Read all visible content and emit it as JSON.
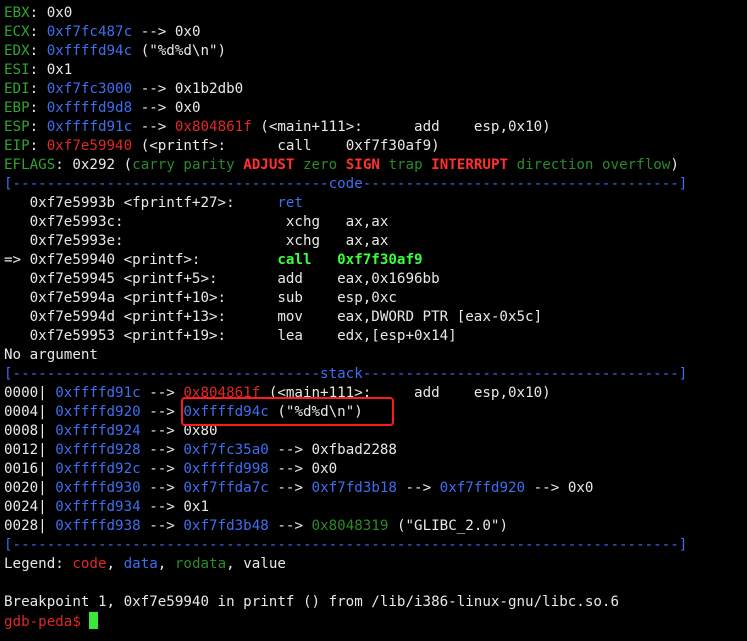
{
  "registers": {
    "ebx": {
      "name": "EBX",
      "value": "0x0"
    },
    "ecx": {
      "name": "ECX",
      "addr": "0xf7fc487c",
      "arrow": "-->",
      "deref": "0x0"
    },
    "edx": {
      "name": "EDX",
      "addr": "0xffffd94c",
      "str": "(\"%d%d\\n\")"
    },
    "esi": {
      "name": "ESI",
      "value": "0x1"
    },
    "edi": {
      "name": "EDI",
      "addr": "0xf7fc3000",
      "arrow": "-->",
      "deref": "0x1b2db0"
    },
    "ebp": {
      "name": "EBP",
      "addr": "0xffffd9d8",
      "arrow": "-->",
      "deref": "0x0"
    },
    "esp": {
      "name": "ESP",
      "addr": "0xffffd91c",
      "arrow": "-->",
      "code": "0x804861f",
      "sym": "(<main+111>:",
      "op": "add",
      "args": "esp,0x10)"
    },
    "eip": {
      "name": "EIP",
      "code": "0xf7e59940",
      "sym": "(<printf>:",
      "op": "call",
      "args": "0xf7f30af9)"
    },
    "eflags": {
      "name": "EFLAGS",
      "value": "0x292",
      "open": "(",
      "carry": "carry",
      "parity": "parity",
      "adjust": "ADJUST",
      "zero": "zero",
      "sign": "SIGN",
      "trap": "trap",
      "interrupt": "INTERRUPT",
      "direction": "direction",
      "overflow": "overflow",
      "close": ")"
    }
  },
  "sections": {
    "code": "[-------------------------------------code-------------------------------------]",
    "stack": "[------------------------------------stack-------------------------------------]",
    "end": "[------------------------------------------------------------------------------]"
  },
  "code": [
    {
      "prefix": "   ",
      "addr": "0xf7e5993b",
      "sym": "<fprintf+27>:",
      "op": "ret",
      "args": ""
    },
    {
      "prefix": "   ",
      "addr": "0xf7e5993c:",
      "sym": "",
      "op": "xchg",
      "args": "ax,ax"
    },
    {
      "prefix": "   ",
      "addr": "0xf7e5993e:",
      "sym": "",
      "op": "xchg",
      "args": "ax,ax"
    },
    {
      "prefix": "=> ",
      "addr": "0xf7e59940",
      "sym": "<printf>:",
      "op": "call",
      "args": "0xf7f30af9"
    },
    {
      "prefix": "   ",
      "addr": "0xf7e59945",
      "sym": "<printf+5>:",
      "op": "add",
      "args": "eax,0x1696bb"
    },
    {
      "prefix": "   ",
      "addr": "0xf7e5994a",
      "sym": "<printf+10>:",
      "op": "sub",
      "args": "esp,0xc"
    },
    {
      "prefix": "   ",
      "addr": "0xf7e5994d",
      "sym": "<printf+13>:",
      "op": "mov",
      "args": "eax,DWORD PTR [eax-0x5c]"
    },
    {
      "prefix": "   ",
      "addr": "0xf7e59953",
      "sym": "<printf+19>:",
      "op": "lea",
      "args": "edx,[esp+0x14]"
    }
  ],
  "no_argument": "No argument",
  "stack": [
    {
      "off": "0000|",
      "addr": "0xffffd91c",
      "rest": [
        [
          "-->",
          "w"
        ],
        [
          "0x804861f",
          "r"
        ],
        [
          "(<main+111>:",
          "w"
        ],
        [
          "add",
          "w"
        ],
        [
          "esp,0x10)",
          "w"
        ]
      ]
    },
    {
      "off": "0004|",
      "addr": "0xffffd920",
      "rest": [
        [
          "-->",
          "w"
        ],
        [
          "0xffffd94c",
          "bl"
        ],
        [
          "(\"%d%d\\n\")",
          "w"
        ]
      ]
    },
    {
      "off": "0008|",
      "addr": "0xffffd924",
      "rest": [
        [
          "-->",
          "w"
        ],
        [
          "0x80",
          "w"
        ]
      ]
    },
    {
      "off": "0012|",
      "addr": "0xffffd928",
      "rest": [
        [
          "-->",
          "w"
        ],
        [
          "0xf7fc35a0",
          "bl"
        ],
        [
          "-->",
          "w"
        ],
        [
          "0xfbad2288",
          "w"
        ]
      ]
    },
    {
      "off": "0016|",
      "addr": "0xffffd92c",
      "rest": [
        [
          "-->",
          "w"
        ],
        [
          "0xffffd998",
          "bl"
        ],
        [
          "-->",
          "w"
        ],
        [
          "0x0",
          "w"
        ]
      ]
    },
    {
      "off": "0020|",
      "addr": "0xffffd930",
      "rest": [
        [
          "-->",
          "w"
        ],
        [
          "0xf7ffda7c",
          "bl"
        ],
        [
          "-->",
          "w"
        ],
        [
          "0xf7fd3b18",
          "bl"
        ],
        [
          "-->",
          "w"
        ],
        [
          "0xf7ffd920",
          "bl"
        ],
        [
          "-->",
          "w"
        ],
        [
          "0x0",
          "w"
        ]
      ]
    },
    {
      "off": "0024|",
      "addr": "0xffffd934",
      "rest": [
        [
          "-->",
          "w"
        ],
        [
          "0x1",
          "w"
        ]
      ]
    },
    {
      "off": "0028|",
      "addr": "0xffffd938",
      "rest": [
        [
          "-->",
          "w"
        ],
        [
          "0xf7fd3b48",
          "bl"
        ],
        [
          "-->",
          "w"
        ],
        [
          "0x8048319",
          "dg"
        ],
        [
          "(\"GLIBC_2.0\")",
          "w"
        ]
      ]
    }
  ],
  "legend": {
    "label": "Legend:",
    "code": "code",
    "data": "data",
    "rodata": "rodata",
    "value": "value"
  },
  "breakpoint": "Breakpoint 1, 0xf7e59940 in printf () from /lib/i386-linux-gnu/libc.so.6",
  "prompt": "gdb-peda$ "
}
